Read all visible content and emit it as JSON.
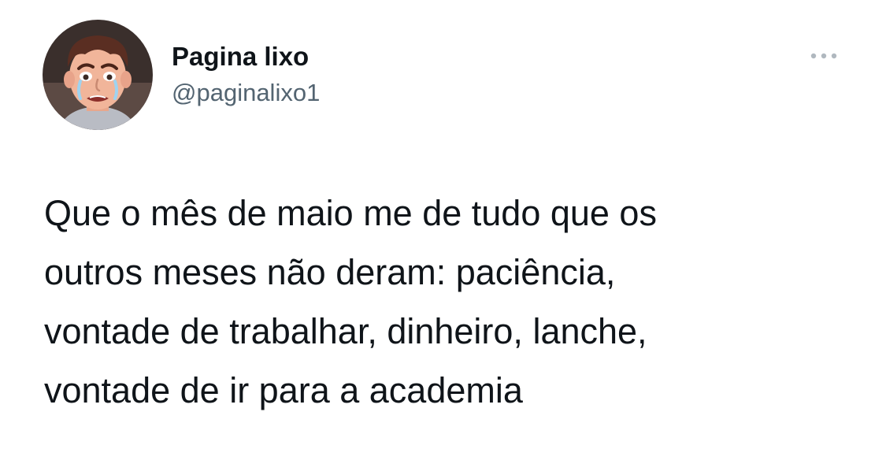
{
  "tweet": {
    "author": {
      "display_name": "Pagina lixo",
      "handle": "@paginalixo1",
      "avatar_icon": "crying-face-avatar"
    },
    "more_icon": "more-options-icon",
    "text": "Que o mês de maio me de tudo que os\noutros meses não deram: paciência,\nvontade de trabalhar, dinheiro, lanche,\nvontade de ir para a academia"
  },
  "colors": {
    "text_primary": "#0f1419",
    "text_secondary": "#536471",
    "icon_gray": "#b0b8bf",
    "background": "#ffffff"
  }
}
